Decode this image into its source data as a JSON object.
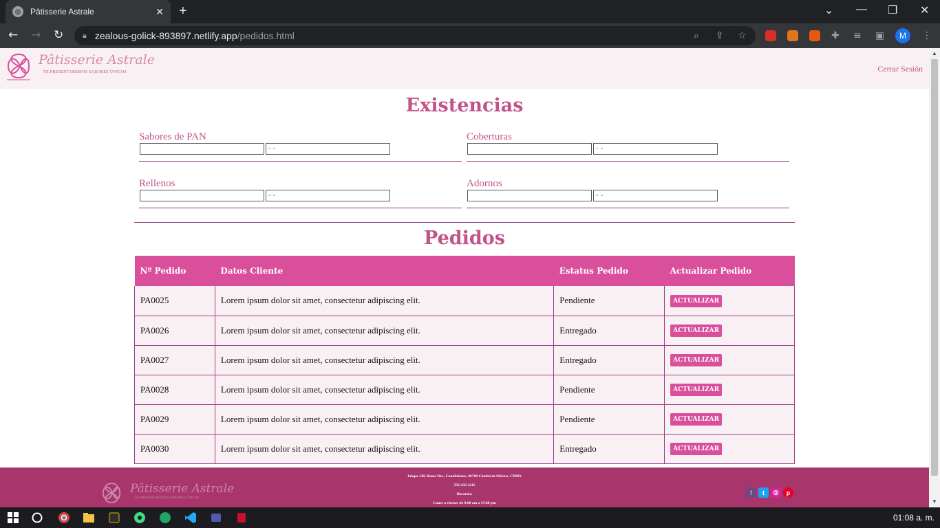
{
  "browser": {
    "tab_title": "Pâtisserie Astrale",
    "url_host": "zealous-golick-893897.netlify.app",
    "url_path": "/pedidos.html",
    "profile_initial": "M"
  },
  "header": {
    "logo_text": "Pâtisserie Astrale",
    "tagline": "TE PRESENTAREMOS SABORES ÚNICOS",
    "logout_label": "Cerrar Sesión"
  },
  "stock": {
    "title": "Existencias",
    "groups": [
      {
        "label": "Sabores de PAN",
        "value": "",
        "quantity_placeholder": "- -"
      },
      {
        "label": "Coberturas",
        "value": "",
        "quantity_placeholder": "- -"
      },
      {
        "label": "Rellenos",
        "value": "",
        "quantity_placeholder": "- -"
      },
      {
        "label": "Adornos",
        "value": "",
        "quantity_placeholder": "- -"
      }
    ]
  },
  "orders": {
    "title": "Pedidos",
    "columns": [
      "Nº Pedido",
      "Datos Cliente",
      "Estatus Pedido",
      "Actualizar Pedido"
    ],
    "button_label": "ACTUALIZAR",
    "rows": [
      {
        "id": "PA0025",
        "client": "Lorem ipsum dolor sit amet, consectetur adipiscing elit.",
        "status": "Pendiente"
      },
      {
        "id": "PA0026",
        "client": "Lorem ipsum dolor sit amet, consectetur adipiscing elit.",
        "status": "Entregado"
      },
      {
        "id": "PA0027",
        "client": "Lorem ipsum dolor sit amet, consectetur adipiscing elit.",
        "status": "Entregado"
      },
      {
        "id": "PA0028",
        "client": "Lorem ipsum dolor sit amet, consectetur adipiscing elit.",
        "status": "Pendiente"
      },
      {
        "id": "PA0029",
        "client": "Lorem ipsum dolor sit amet, consectetur adipiscing elit.",
        "status": "Pendiente"
      },
      {
        "id": "PA0030",
        "client": "Lorem ipsum dolor sit amet, consectetur adipiscing elit.",
        "status": "Entregado"
      }
    ]
  },
  "footer": {
    "logo_text": "Pâtisserie Astrale",
    "tagline": "TE PRESENTAREMOS SABORES ÚNICOS",
    "address": "Jalapa 128, Roma Nte., Cuauhtémoc, 06700 Ciudad de México, CDMX",
    "phone": "556-433-2211",
    "hours_label": "Horarios:",
    "hours": "Lunes a viernes de 9:00 am a 17:00 pm",
    "social": [
      "facebook-icon",
      "twitter-icon",
      "instagram-icon",
      "pinterest-icon"
    ]
  },
  "taskbar": {
    "clock": "01:08 a. m."
  },
  "colors": {
    "accent": "#d94f9c",
    "accent_text": "#c2528a",
    "footer_bg": "#a9356d",
    "row_bg": "#f9f0f3",
    "border": "#9b3a8a"
  }
}
